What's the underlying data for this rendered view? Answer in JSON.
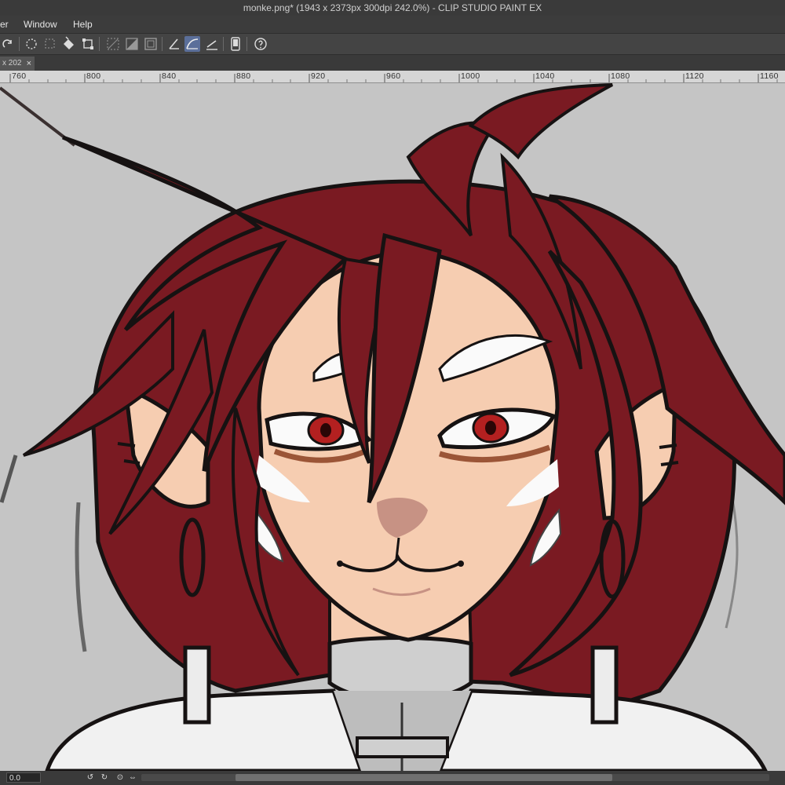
{
  "window": {
    "title": "monke.png* (1943 x 2373px 300dpi 242.0%)  - CLIP STUDIO PAINT EX"
  },
  "menu": {
    "items": [
      "er",
      "Window",
      "Help"
    ]
  },
  "toolbar": {
    "icons": [
      "redo-icon",
      "select-all-icon",
      "deselect-icon",
      "fill-icon",
      "transform-icon",
      "hide-selection-icon",
      "invert-selection-icon",
      "border-icon",
      "ruler-snap-icon",
      "curve-snap-icon",
      "special-ruler-snap-icon",
      "tablet-icon",
      "help-icon"
    ]
  },
  "tab": {
    "label": "x 202",
    "close": "×"
  },
  "ruler": {
    "labels": [
      "760",
      "800",
      "840",
      "880",
      "920",
      "960",
      "1000",
      "1040",
      "1080",
      "1120",
      "1160"
    ]
  },
  "status": {
    "zoom": "0.0"
  },
  "colors": {
    "hair": "#7a1a22",
    "skin": "#f6cdb1",
    "canvas_bg": "#c5c5c5",
    "outline": "#161212"
  }
}
